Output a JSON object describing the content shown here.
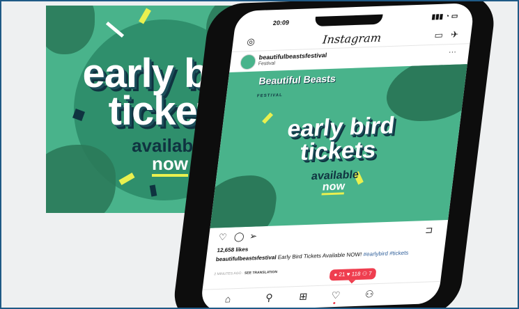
{
  "poster": {
    "line1": "early bird",
    "line2": "tickets",
    "line3": "available",
    "line4": "now"
  },
  "phone": {
    "status_time": "20:09",
    "status_icons": "▮▮▮ ◔ ▭",
    "app_title": "Instagram",
    "account_name": "beautifulbeastsfestival",
    "account_sub": "Festival",
    "post_image": {
      "brand_line": "Beautiful Beasts",
      "brand_sub": "FESTIVAL",
      "line1": "early bird",
      "line2": "tickets",
      "line3": "available",
      "line4": "now"
    },
    "likes": "12,658 likes",
    "caption_user": "beautifulbeastsfestival",
    "caption_text": " Early Bird Tickets Available NOW! ",
    "caption_tags": "#earlybird #tickets",
    "meta_time": "2 MINUTES AGO",
    "meta_separator": " · ",
    "meta_translate": "SEE TRANSLATION",
    "notification": {
      "comments": "21",
      "likes": "118",
      "follows": "7"
    }
  },
  "icons": {
    "camera": "◎",
    "igtv": "▭",
    "direct": "✈",
    "more": "···",
    "heart": "♡",
    "comment": "◯",
    "share": "➢",
    "bookmark": "⊐",
    "home": "⌂",
    "search": "⚲",
    "add": "⊞",
    "activity": "♡",
    "profile": "⚇"
  },
  "colors": {
    "frame_border": "#1f5a86",
    "poster_green": "#49b38b",
    "dark_teal": "#0f3340",
    "yellow": "#e9f04f",
    "notif_red": "#ef3e4f"
  }
}
